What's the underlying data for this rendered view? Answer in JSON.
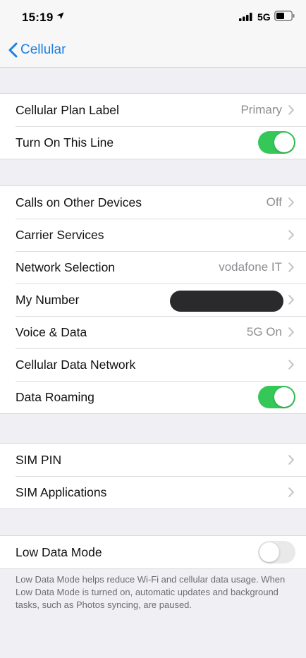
{
  "status_bar": {
    "time": "15:19",
    "network": "5G",
    "icons": [
      "location-arrow-icon",
      "signal-bars-icon",
      "battery-icon"
    ]
  },
  "nav": {
    "back_label": "Cellular",
    "back_icon": "chevron-left-icon"
  },
  "groups": [
    {
      "rows": [
        {
          "label": "Cellular Plan Label",
          "value": "Primary",
          "chevron": true
        },
        {
          "label": "Turn On This Line",
          "toggle": true
        }
      ]
    },
    {
      "rows": [
        {
          "label": "Calls on Other Devices",
          "value": "Off",
          "chevron": true
        },
        {
          "label": "Carrier Services",
          "chevron": true
        },
        {
          "label": "Network Selection",
          "value": "vodafone IT",
          "chevron": true
        },
        {
          "label": "My Number",
          "value_redacted": true,
          "chevron": true
        },
        {
          "label": "Voice & Data",
          "value": "5G On",
          "chevron": true
        },
        {
          "label": "Cellular Data Network",
          "chevron": true
        },
        {
          "label": "Data Roaming",
          "toggle": true
        }
      ]
    },
    {
      "rows": [
        {
          "label": "SIM PIN",
          "chevron": true
        },
        {
          "label": "SIM Applications",
          "chevron": true
        }
      ]
    },
    {
      "rows": [
        {
          "label": "Low Data Mode",
          "toggle": false
        }
      ],
      "footer": "Low Data Mode helps reduce Wi-Fi and cellular data usage. When Low Data Mode is turned on, automatic updates and background tasks, such as Photos syncing, are paused."
    }
  ],
  "colors": {
    "accent": "#1c7fe2",
    "toggle_on": "#35c859",
    "toggle_off": "#e9e9ea",
    "background": "#efeff4",
    "secondary_text": "#8e8e93"
  }
}
